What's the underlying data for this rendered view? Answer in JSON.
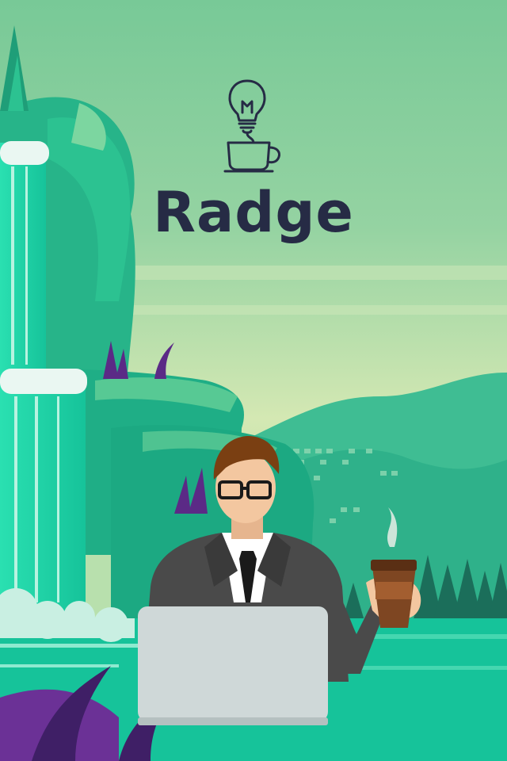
{
  "splash": {
    "app_name": "Radge",
    "logo_icon": "lightbulb-coffee-cup-icon",
    "illustration": "businessman-laptop-coffee-waterfall-illustration"
  },
  "colors": {
    "title": "#262b45",
    "sky_top": "#78c997",
    "sky_bottom": "#d9e8b4",
    "teal": "#1dc79f",
    "water": "#2ae0b1",
    "purple": "#5b2a86",
    "suit": "#4a4a4a",
    "laptop": "#cfd8d8"
  }
}
